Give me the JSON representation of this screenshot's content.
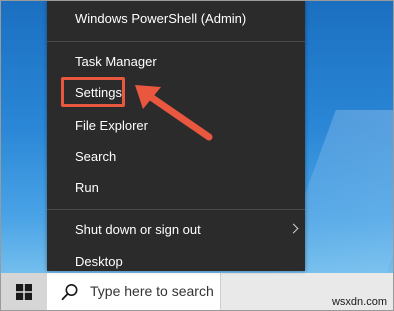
{
  "menu": {
    "items": [
      {
        "label": "Windows PowerShell (Admin)"
      },
      {
        "label": "Task Manager"
      },
      {
        "label": "Settings"
      },
      {
        "label": "File Explorer"
      },
      {
        "label": "Search"
      },
      {
        "label": "Run"
      },
      {
        "label": "Shut down or sign out"
      },
      {
        "label": "Desktop"
      }
    ]
  },
  "taskbar": {
    "search_placeholder": "Type here to search"
  },
  "watermark": "wsxdn.com",
  "colors": {
    "menu_background": "#2b2b2b",
    "highlight": "#e9573f",
    "taskbar": "#e9e9e9",
    "desktop": "#2a86d6"
  }
}
